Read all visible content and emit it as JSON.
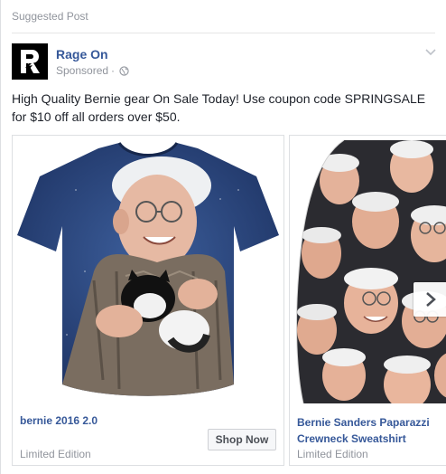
{
  "header": {
    "label": "Suggested Post"
  },
  "advertiser": {
    "name": "Rage On",
    "sponsored_label": "Sponsored",
    "separator": "·"
  },
  "post": {
    "text": "High Quality Bernie gear On Sale Today! Use coupon code SPRINGSALE for $10 off all orders over $50."
  },
  "carousel": {
    "items": [
      {
        "title": "bernie 2016 2.0",
        "subtitle": "Limited Edition",
        "cta": "Shop Now"
      },
      {
        "title": "Bernie Sanders Paparazzi Crewneck Sweatshirt",
        "subtitle": "Limited Edition"
      }
    ]
  },
  "icons": {
    "avatar": "rage-on-logo",
    "privacy": "globe-icon",
    "menu": "chevron-down-icon",
    "next": "chevron-right-icon"
  },
  "colors": {
    "link": "#365899",
    "meta": "#90949c",
    "text": "#1d2129",
    "shirt": "#2d4a82"
  }
}
